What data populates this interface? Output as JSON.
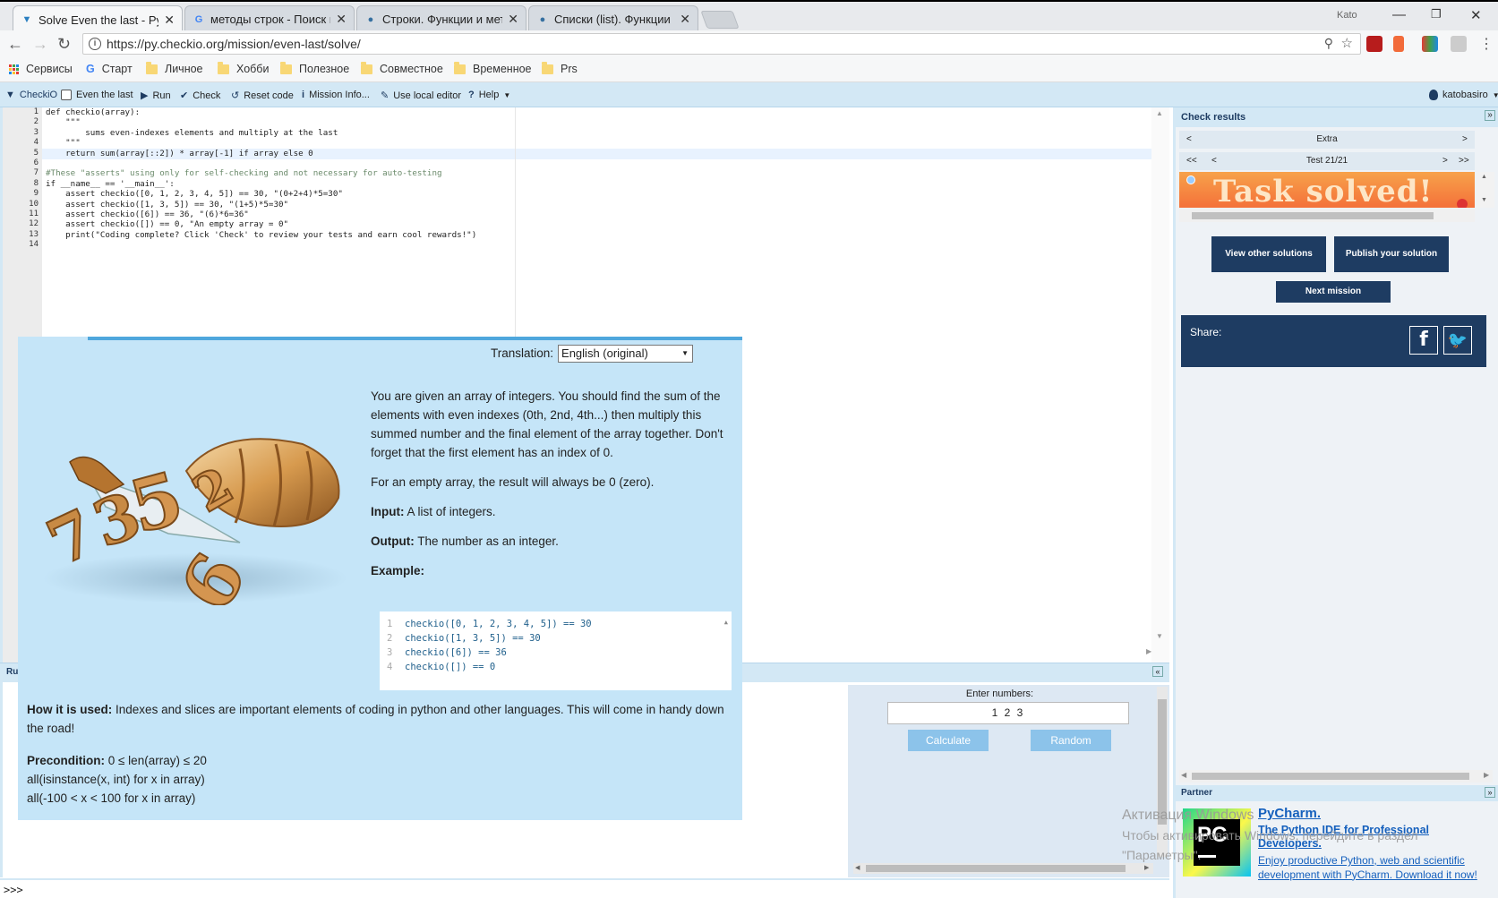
{
  "browser": {
    "tabs": [
      {
        "title": "Solve Even the last - Py.C",
        "active": true
      },
      {
        "title": "методы строк - Поиск в",
        "active": false
      },
      {
        "title": "Строки. Функции и мет",
        "active": false
      },
      {
        "title": "Списки (list). Функции и",
        "active": false
      }
    ],
    "profile": "Kato",
    "url": "https://py.checkio.org/mission/even-last/solve/",
    "bookmarks": [
      "Сервисы",
      "Старт",
      "Личное",
      "Хобби",
      "Полезное",
      "Совместное",
      "Временное",
      "Prs"
    ]
  },
  "toolbar": {
    "logo": "CheckiO",
    "mission": "Even the last",
    "run": "Run",
    "check": "Check",
    "reset": "Reset code",
    "info": "Mission Info...",
    "local_editor": "Use local editor",
    "help": "Help",
    "user": "katobasiro"
  },
  "editor": {
    "lines": [
      "def checkio(array):",
      "    \"\"\"",
      "        sums even-indexes elements and multiply at the last",
      "    \"\"\"",
      "    return sum(array[::2]) * array[-1] if array else 0",
      "",
      "#These \"asserts\" using only for self-checking and not necessary for auto-testing",
      "if __name__ == '__main__':",
      "    assert checkio([0, 1, 2, 3, 4, 5]) == 30, \"(0+2+4)*5=30\"",
      "    assert checkio([1, 3, 5]) == 30, \"(1+5)*5=30\"",
      "    assert checkio([6]) == 36, \"(6)*6=36\"",
      "    assert checkio([]) == 0, \"An empty array = 0\"",
      "    print(\"Coding complete? Click 'Check' to review your tests and earn cool rewards!\")",
      ""
    ]
  },
  "check_results": {
    "title": "Check results",
    "category": "Extra",
    "test_label": "Test 21/21",
    "banner": "Task solved!",
    "view_solutions": "View other solutions",
    "publish": "Publish your solution",
    "next_mission": "Next mission",
    "share": "Share:"
  },
  "partner": {
    "title": "Partner",
    "name": "PyCharm.",
    "tagline": "The Python IDE for Professional Developers.",
    "body": "Enjoy productive Python, web and scientific development with PyCharm. Download it now!"
  },
  "run_panel": {
    "label": "Ru",
    "enter_label": "Enter numbers:",
    "input_value": "1 2 3",
    "calculate": "Calculate",
    "random": "Random",
    "prompt": ">>>"
  },
  "mission_info": {
    "translation_label": "Translation:",
    "translation_value": "English (original)",
    "intro": "You are given an array of integers. You should find the sum of the elements with even indexes (0th, 2nd, 4th...) then multiply this summed number and the final element of the array together. Don't forget that the first element has an index of 0.",
    "empty_note": "For an empty array, the result will always be 0 (zero).",
    "input_label": "Input:",
    "input_text": "A list of integers.",
    "output_label": "Output:",
    "output_text": "The number as an integer.",
    "example_label": "Example:",
    "example_lines": [
      "checkio([0, 1, 2, 3, 4, 5]) == 30",
      "checkio([1, 3, 5]) == 30",
      "checkio([6]) == 36",
      "checkio([]) == 0"
    ],
    "how_label": "How it is used:",
    "how_text": "Indexes and slices are important elements of coding in python and other languages. This will come in handy down the road!",
    "precondition_label": "Precondition:",
    "precondition_lines": [
      "0 ≤ len(array) ≤ 20",
      "all(isinstance(x, int) for x in array)",
      "all(-100 < x < 100 for x in array)"
    ]
  },
  "watermark": {
    "line1": "Активация Windows",
    "line2": "Чтобы активировать Windows, перейдите в раздел",
    "line3": "\"Параметры\"."
  },
  "colors": {
    "accent_blue": "#d3e8f5",
    "overlay_bg": "#c5e5f8",
    "dark_button": "#1e3c62",
    "calc_button": "#8cc3ea"
  }
}
